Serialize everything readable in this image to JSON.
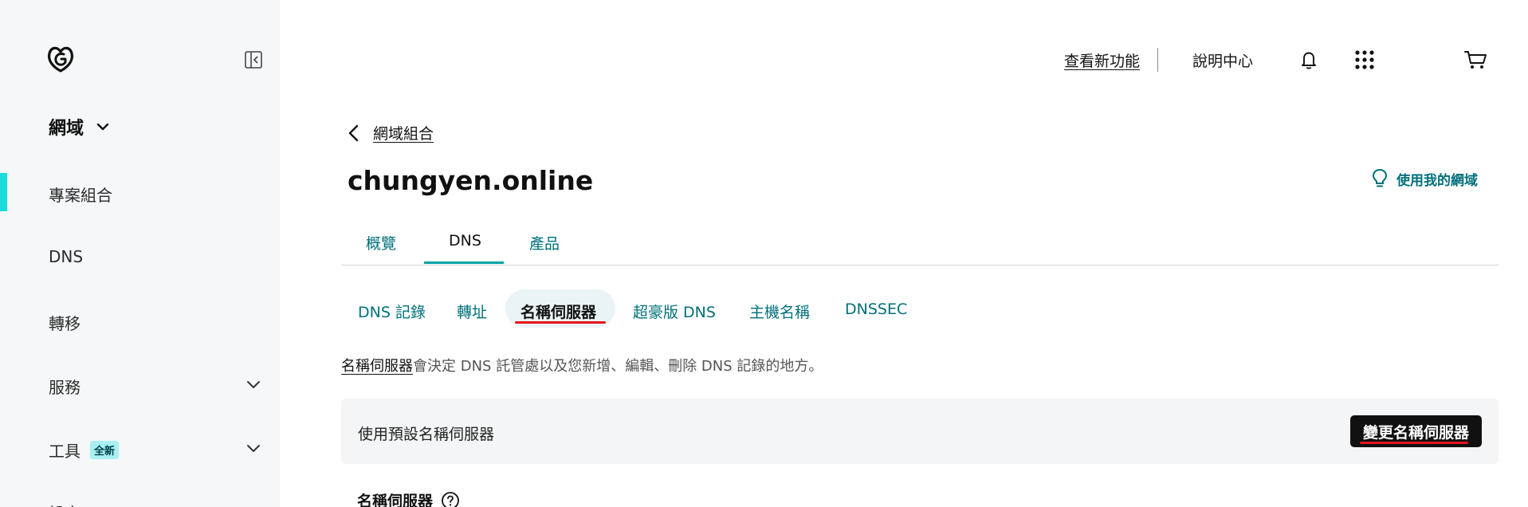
{
  "sidebar": {
    "section_title": "網域",
    "items": [
      {
        "label": "專案組合"
      },
      {
        "label": "DNS"
      },
      {
        "label": "轉移"
      },
      {
        "label": "服務"
      },
      {
        "label": "工具",
        "badge": "全新"
      },
      {
        "label": "設定"
      }
    ],
    "active_color": "#1bdbdb",
    "badge_color": "#a8f0f2"
  },
  "topbar": {
    "whats_new": "查看新功能",
    "help_center": "說明中心",
    "icons": [
      "bell-icon",
      "apps-grid-icon",
      "cart-icon"
    ]
  },
  "breadcrumb": {
    "back_label": "網域組合"
  },
  "page": {
    "domain": "chungyen.online",
    "help_link": "使用我的網域",
    "accent_color": "#00707a"
  },
  "tabs": [
    {
      "label": "概覽"
    },
    {
      "label": "DNS"
    },
    {
      "label": "產品"
    }
  ],
  "subtabs": [
    {
      "label": "DNS 記錄"
    },
    {
      "label": "轉址"
    },
    {
      "label": "名稱伺服器"
    },
    {
      "label": "超豪版 DNS"
    },
    {
      "label": "主機名稱"
    },
    {
      "label": "DNSSEC"
    }
  ],
  "nameservers": {
    "description_link": "名稱伺服器",
    "description_rest": "會決定 DNS 託管處以及您新增、編輯、刪除 DNS 記錄的地方。",
    "panel_text": "使用預設名稱伺服器",
    "change_button": "變更名稱伺服器",
    "section_title": "名稱伺服器"
  }
}
